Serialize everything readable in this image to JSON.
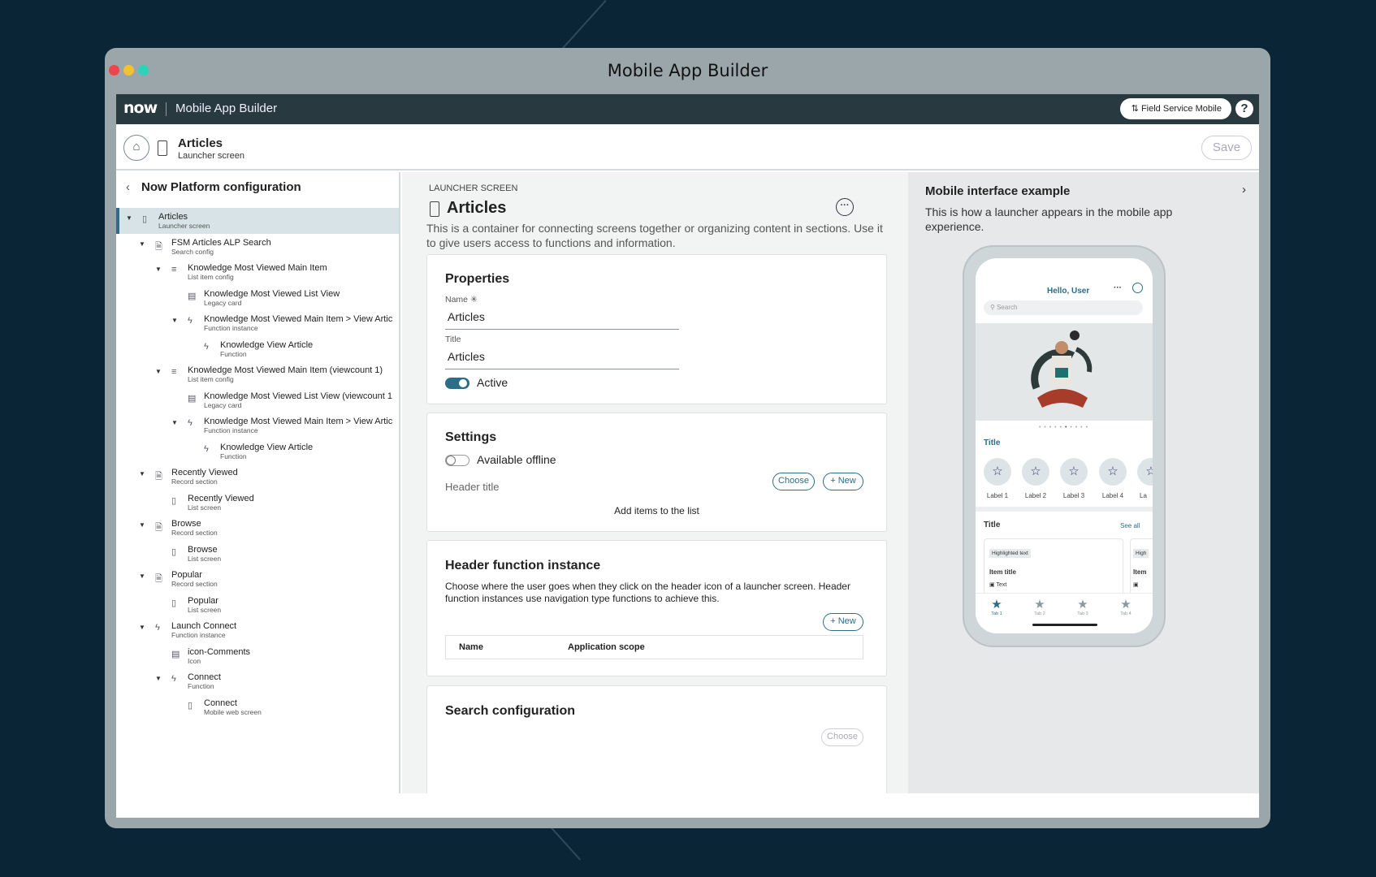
{
  "window": {
    "title": "Mobile App Builder"
  },
  "topbar": {
    "logo": "now",
    "app_name": "Mobile App Builder",
    "instance_label": "Field Service Mobile",
    "help": "?"
  },
  "subheader": {
    "title": "Articles",
    "subtitle": "Launcher screen",
    "save_label": "Save"
  },
  "left_panel": {
    "heading": "Now Platform configuration",
    "nodes": [
      {
        "label": "Articles",
        "sub": "Launcher screen"
      },
      {
        "label": "FSM Articles ALP Search",
        "sub": "Search config"
      },
      {
        "label": "Knowledge Most Viewed Main Item",
        "sub": "List item config"
      },
      {
        "label": "Knowledge Most Viewed List View",
        "sub": "Legacy card"
      },
      {
        "label": "Knowledge Most Viewed Main Item > View Artic",
        "sub": "Function instance"
      },
      {
        "label": "Knowledge View Article",
        "sub": "Function"
      },
      {
        "label": "Knowledge Most Viewed Main Item (viewcount 1)",
        "sub": "List item config"
      },
      {
        "label": "Knowledge Most Viewed List View (viewcount 1",
        "sub": "Legacy card"
      },
      {
        "label": "Knowledge Most Viewed Main Item > View Artic",
        "sub": "Function instance"
      },
      {
        "label": "Knowledge View Article",
        "sub": "Function"
      },
      {
        "label": "Recently Viewed",
        "sub": "Record section"
      },
      {
        "label": "Recently Viewed",
        "sub": "List screen"
      },
      {
        "label": "Browse",
        "sub": "Record section"
      },
      {
        "label": "Browse",
        "sub": "List screen"
      },
      {
        "label": "Popular",
        "sub": "Record section"
      },
      {
        "label": "Popular",
        "sub": "List screen"
      },
      {
        "label": "Launch Connect",
        "sub": "Function instance"
      },
      {
        "label": "icon-Comments",
        "sub": "Icon"
      },
      {
        "label": "Connect",
        "sub": "Function"
      },
      {
        "label": "Connect",
        "sub": "Mobile web screen"
      }
    ]
  },
  "main": {
    "kicker": "LAUNCHER SCREEN",
    "title": "Articles",
    "description": "This is a container for connecting screens together or organizing content in sections. Use it to give users access to functions and information.",
    "properties": {
      "heading": "Properties",
      "name_label": "Name",
      "name_value": "Articles",
      "title_label": "Title",
      "title_value": "Articles",
      "active_label": "Active",
      "active": true
    },
    "settings": {
      "heading": "Settings",
      "offline_label": "Available offline",
      "offline": false,
      "header_title_label": "Header title",
      "choose_label": "Choose",
      "new_label": "+ New",
      "empty_text": "Add items to the list"
    },
    "header_function": {
      "heading": "Header function instance",
      "description": "Choose where the user goes when they click on the header icon of a launcher screen. Header function instances use navigation type functions to achieve this.",
      "new_label": "+ New",
      "columns": [
        "Name",
        "Application scope"
      ]
    },
    "search_config": {
      "heading": "Search configuration",
      "choose_label": "Choose"
    }
  },
  "right_panel": {
    "heading": "Mobile interface example",
    "description": "This is how a launcher appears in the mobile app experience.",
    "preview": {
      "greeting": "Hello, User",
      "search_placeholder": "Search",
      "section1_title": "Title",
      "shortcuts": [
        "Label 1",
        "Label 2",
        "Label 3",
        "Label 4",
        "La"
      ],
      "section2_title": "Title",
      "see_all": "See all",
      "highlight": "Highlighted text",
      "highlight2": "High",
      "item_title": "Item title",
      "item_title2": "Item",
      "item_text": "Text",
      "tabs": [
        "Tab 1",
        "Tab 2",
        "Tab 3",
        "Tab 4"
      ]
    }
  },
  "colors": {
    "accent": "#2d6d85",
    "topbar": "#283940",
    "selected_row": "#d8e3e8",
    "background": "#0a2535"
  }
}
